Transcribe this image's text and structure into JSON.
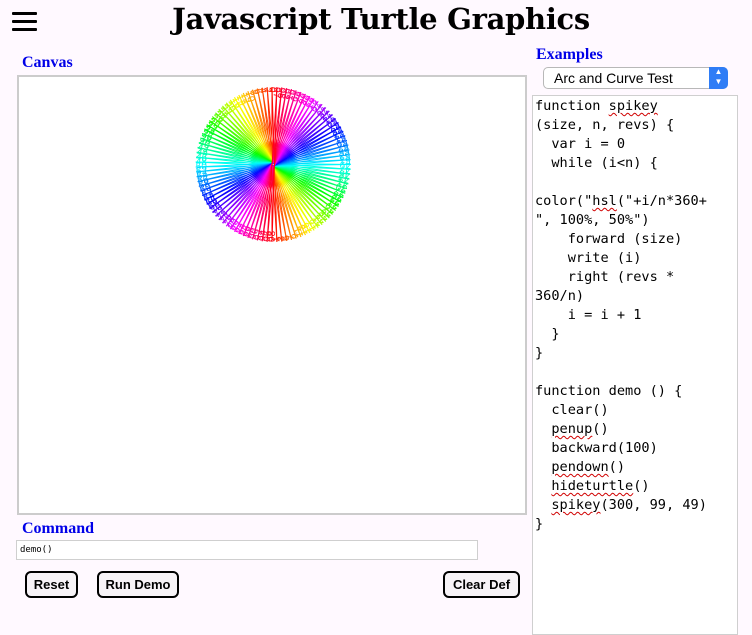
{
  "app": {
    "title": "Javascript Turtle Graphics",
    "menu_icon": "hamburger-menu-icon"
  },
  "canvas": {
    "label": "Canvas"
  },
  "command": {
    "label": "Command",
    "value": "demo()"
  },
  "buttons": {
    "reset": "Reset",
    "run_demo": "Run Demo",
    "clear_def": "Clear Def"
  },
  "examples": {
    "label": "Examples",
    "selected": "Arc and Curve Test"
  },
  "editor": {
    "lines": [
      "function spikey",
      "(size, n, revs) {",
      "  var i = 0",
      "  while (i<n) {",
      "",
      "color(\"hsl(\"+i/n*360+",
      "\", 100%, 50%\")",
      "    forward (size)",
      "    write (i)",
      "    right (revs *",
      "360/n)",
      "    i = i + 1",
      "  }",
      "}",
      "",
      "function demo () {",
      "  clear()",
      "  penup()",
      "  backward(100)",
      "  pendown()",
      "  hideturtle()",
      "  spikey(300, 99, 49)",
      "}"
    ],
    "misspelled_words": [
      "spikey",
      "hsl",
      "penup",
      "pendown",
      "hideturtle"
    ]
  },
  "drawing": {
    "spike_count": 99,
    "revolutions": 49,
    "spike_size": 300,
    "first_label": 0,
    "last_label": 98
  }
}
